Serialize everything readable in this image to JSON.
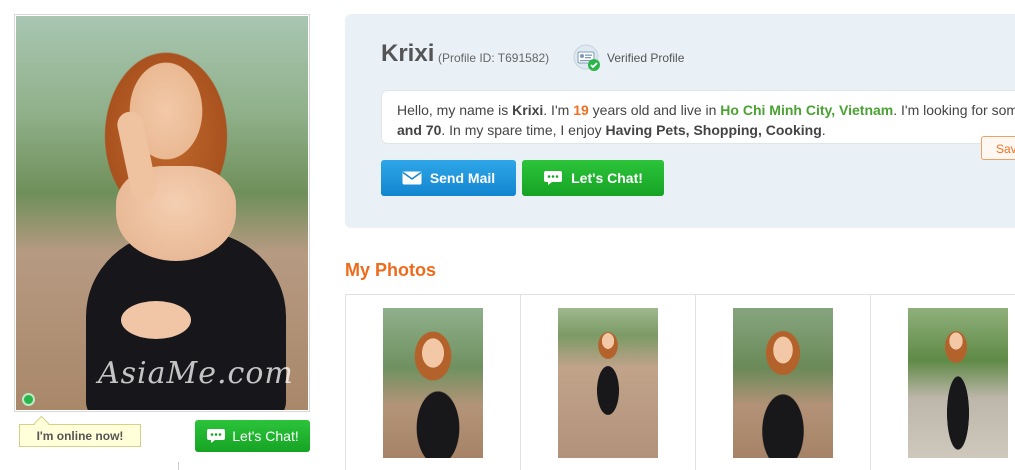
{
  "profile": {
    "name": "Krixi",
    "profile_id_text": "(Profile ID: T691582)",
    "verified_label": "Verified Profile",
    "watermark": "AsiaMe.com",
    "online_label": "I'm online now!",
    "chat_small_label": "Let's Chat!",
    "status_color": "#2bb64a"
  },
  "bio": {
    "part1": "Hello, my name is ",
    "name": "Krixi",
    "part2": ". I'm ",
    "age": "19",
    "part3": " years old and live in ",
    "location": "Ho Chi Minh City, Vietnam",
    "part4": ". I'm looking for som",
    "line2_bold": "and 70",
    "line2_part": ". In my spare time, I enjoy ",
    "hobbies": "Having Pets, Shopping, Cooking",
    "line2_end": "."
  },
  "actions": {
    "save_label": "Sav",
    "send_mail_label": "Send Mail",
    "lets_chat_label": "Let's Chat!"
  },
  "photos": {
    "title": "My Photos"
  },
  "colors": {
    "accent_orange": "#ef6b1c",
    "location_green": "#4aa233",
    "chat_green": "#16a324",
    "mail_blue": "#1285cf",
    "panel_bg": "#e9f0f6"
  },
  "icons": {
    "mail": "envelope-icon",
    "chat": "chat-bubble-icon",
    "verified": "id-card-check-icon"
  }
}
